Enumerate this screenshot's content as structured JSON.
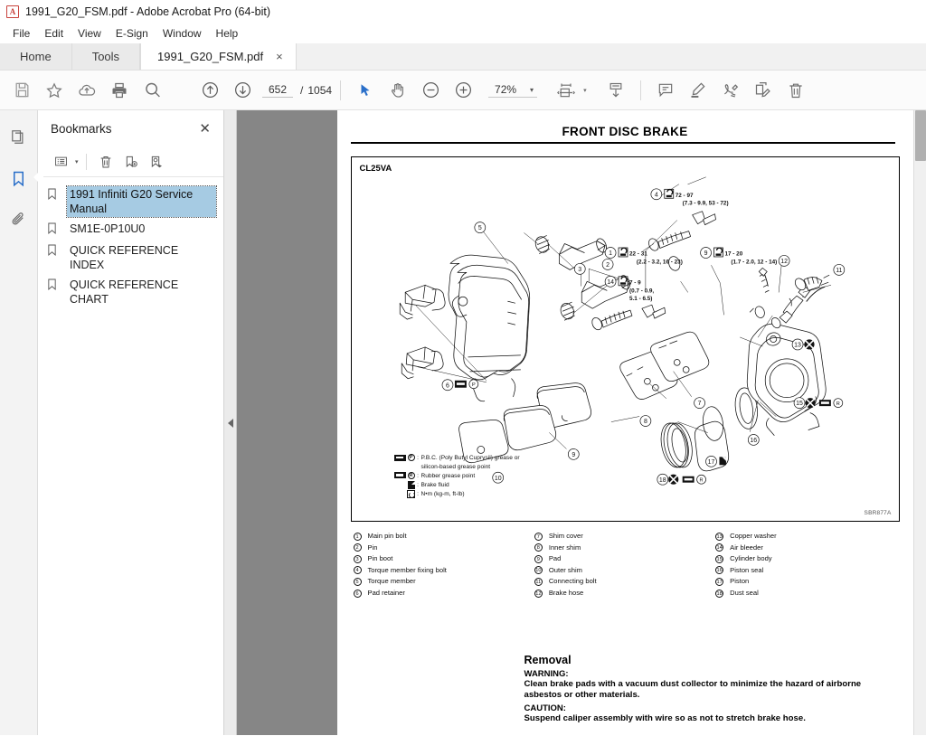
{
  "window": {
    "app_icon": "acrobat-icon",
    "title": "1991_G20_FSM.pdf - Adobe Acrobat Pro (64-bit)"
  },
  "menubar": {
    "items": [
      "File",
      "Edit",
      "View",
      "E-Sign",
      "Window",
      "Help"
    ]
  },
  "tabs": {
    "home": "Home",
    "tools": "Tools",
    "document": "1991_G20_FSM.pdf",
    "close": "×"
  },
  "toolbar": {
    "save_icon": "save-icon",
    "star_icon": "star-icon",
    "cloud_icon": "cloud-upload-icon",
    "print_icon": "print-icon",
    "search_icon": "search-icon",
    "prev_page_icon": "arrow-up-circle-icon",
    "next_page_icon": "arrow-down-circle-icon",
    "page_current": "652",
    "page_separator": "/",
    "page_total": "1054",
    "select_icon": "cursor-arrow-icon",
    "hand_icon": "hand-tool-icon",
    "zoom_out_icon": "zoom-out-icon",
    "zoom_in_icon": "zoom-in-icon",
    "zoom_value": "72%",
    "zoom_caret": "▾",
    "fit_icon": "fit-page-icon",
    "fit_caret": "▾",
    "scroll_icon": "scroll-mode-icon",
    "comment_icon": "comment-icon",
    "highlight_icon": "highlighter-icon",
    "signature_icon": "signature-icon",
    "organize_icon": "edit-pdf-icon",
    "delete_icon": "trash-icon"
  },
  "rail": {
    "pages_icon": "page-thumbnails-icon",
    "bookmarks_icon": "bookmark-icon",
    "attachments_icon": "paperclip-icon"
  },
  "bookmarks": {
    "title": "Bookmarks",
    "close": "✕",
    "toolbar": {
      "options_icon": "list-options-icon",
      "options_caret": "▾",
      "delete_icon": "trash-icon",
      "new_icon": "new-bookmark-icon",
      "goto_icon": "goto-bookmark-icon"
    },
    "items": [
      {
        "label": "1991 Infiniti G20 Service Manual",
        "selected": true
      },
      {
        "label": "SM1E-0P10U0",
        "selected": false
      },
      {
        "label": "QUICK REFERENCE INDEX",
        "selected": false
      },
      {
        "label": "QUICK REFERENCE CHART",
        "selected": false
      }
    ]
  },
  "panel_collapse": {
    "arrow": "◀"
  },
  "document": {
    "page_title": "FRONT DISC BRAKE",
    "figure": {
      "code": "CL25VA",
      "reference": "SBR877A",
      "callouts": [
        {
          "num": "1",
          "torque": "22 - 31",
          "sub": "(2.2 - 3.2, 16 - 23)"
        },
        {
          "num": "4",
          "torque": "72 - 97",
          "sub": "(7.3 - 9.9, 53 - 72)"
        },
        {
          "num": "9",
          "torque": "17 - 20",
          "sub": "(1.7 - 2.0, 12 - 14)"
        },
        {
          "num": "14",
          "torque": "7 - 9",
          "sub": "(0.7 - 0.9,",
          "sub2": "5.1 - 6.5)"
        }
      ],
      "plain_numbers": [
        "2",
        "3",
        "5",
        "6",
        "7",
        "8",
        "9",
        "10",
        "11",
        "12",
        "13",
        "15",
        "16",
        "17",
        "18"
      ],
      "legend": [
        {
          "symbols": [
            "grease-bar",
            "circle-P"
          ],
          "text": "P.B.C. (Poly Butyl Cuprysil) grease or",
          "text2": "silicon-based grease point"
        },
        {
          "symbols": [
            "grease-bar",
            "circle-R"
          ],
          "text": "Rubber grease point"
        },
        {
          "symbols": [
            "fluid-square"
          ],
          "text": "Brake fluid"
        },
        {
          "symbols": [
            "torque-square"
          ],
          "text": "N•m (kg-m, ft-lb)"
        }
      ]
    },
    "parts_list": {
      "column1": [
        {
          "num": "1",
          "name": "Main pin bolt"
        },
        {
          "num": "2",
          "name": "Pin"
        },
        {
          "num": "3",
          "name": "Pin boot"
        },
        {
          "num": "4",
          "name": "Torque member fixing bolt"
        },
        {
          "num": "5",
          "name": "Torque member"
        },
        {
          "num": "6",
          "name": "Pad retainer"
        }
      ],
      "column2": [
        {
          "num": "7",
          "name": "Shim cover"
        },
        {
          "num": "8",
          "name": "Inner shim"
        },
        {
          "num": "9",
          "name": "Pad"
        },
        {
          "num": "10",
          "name": "Outer shim"
        },
        {
          "num": "11",
          "name": "Connecting bolt"
        },
        {
          "num": "12",
          "name": "Brake hose"
        }
      ],
      "column3": [
        {
          "num": "13",
          "name": "Copper washer"
        },
        {
          "num": "14",
          "name": "Air bleeder"
        },
        {
          "num": "15",
          "name": "Cylinder body"
        },
        {
          "num": "16",
          "name": "Piston seal"
        },
        {
          "num": "17",
          "name": "Piston"
        },
        {
          "num": "18",
          "name": "Dust seal"
        }
      ]
    },
    "removal": {
      "heading": "Removal",
      "warning_label": "WARNING:",
      "warning_text": "Clean brake pads with a vacuum dust collector to minimize the hazard of airborne asbestos or other materials.",
      "caution_label": "CAUTION:",
      "caution_text": "Suspend caliper assembly with wire so as not to stretch brake hose."
    }
  },
  "colors": {
    "accent": "#2a6fc9",
    "selection": "#a6cbe3",
    "viewport_bg": "#868686",
    "toolbar_bg": "#fbfbfb"
  }
}
